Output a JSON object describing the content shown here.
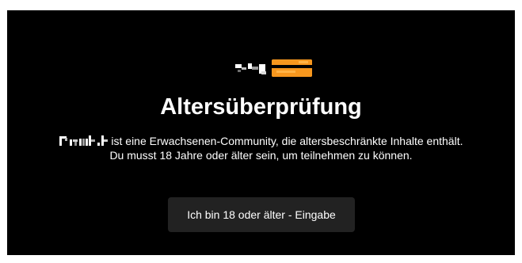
{
  "dialog": {
    "logo_icon": "site-logo",
    "title": "Altersüberprüfung",
    "description_line1": "ist eine Erwachsenen-Community, die altersbeschränkte Inhalte enthält.",
    "description_line2": "Du musst 18 Jahre oder älter sein, um teilnehmen zu können.",
    "enter_button_label": "Ich bin 18 oder älter - Eingabe"
  },
  "colors": {
    "background": "#000000",
    "accent": "#f7971e",
    "button_background": "#222222",
    "text": "#ffffff"
  }
}
